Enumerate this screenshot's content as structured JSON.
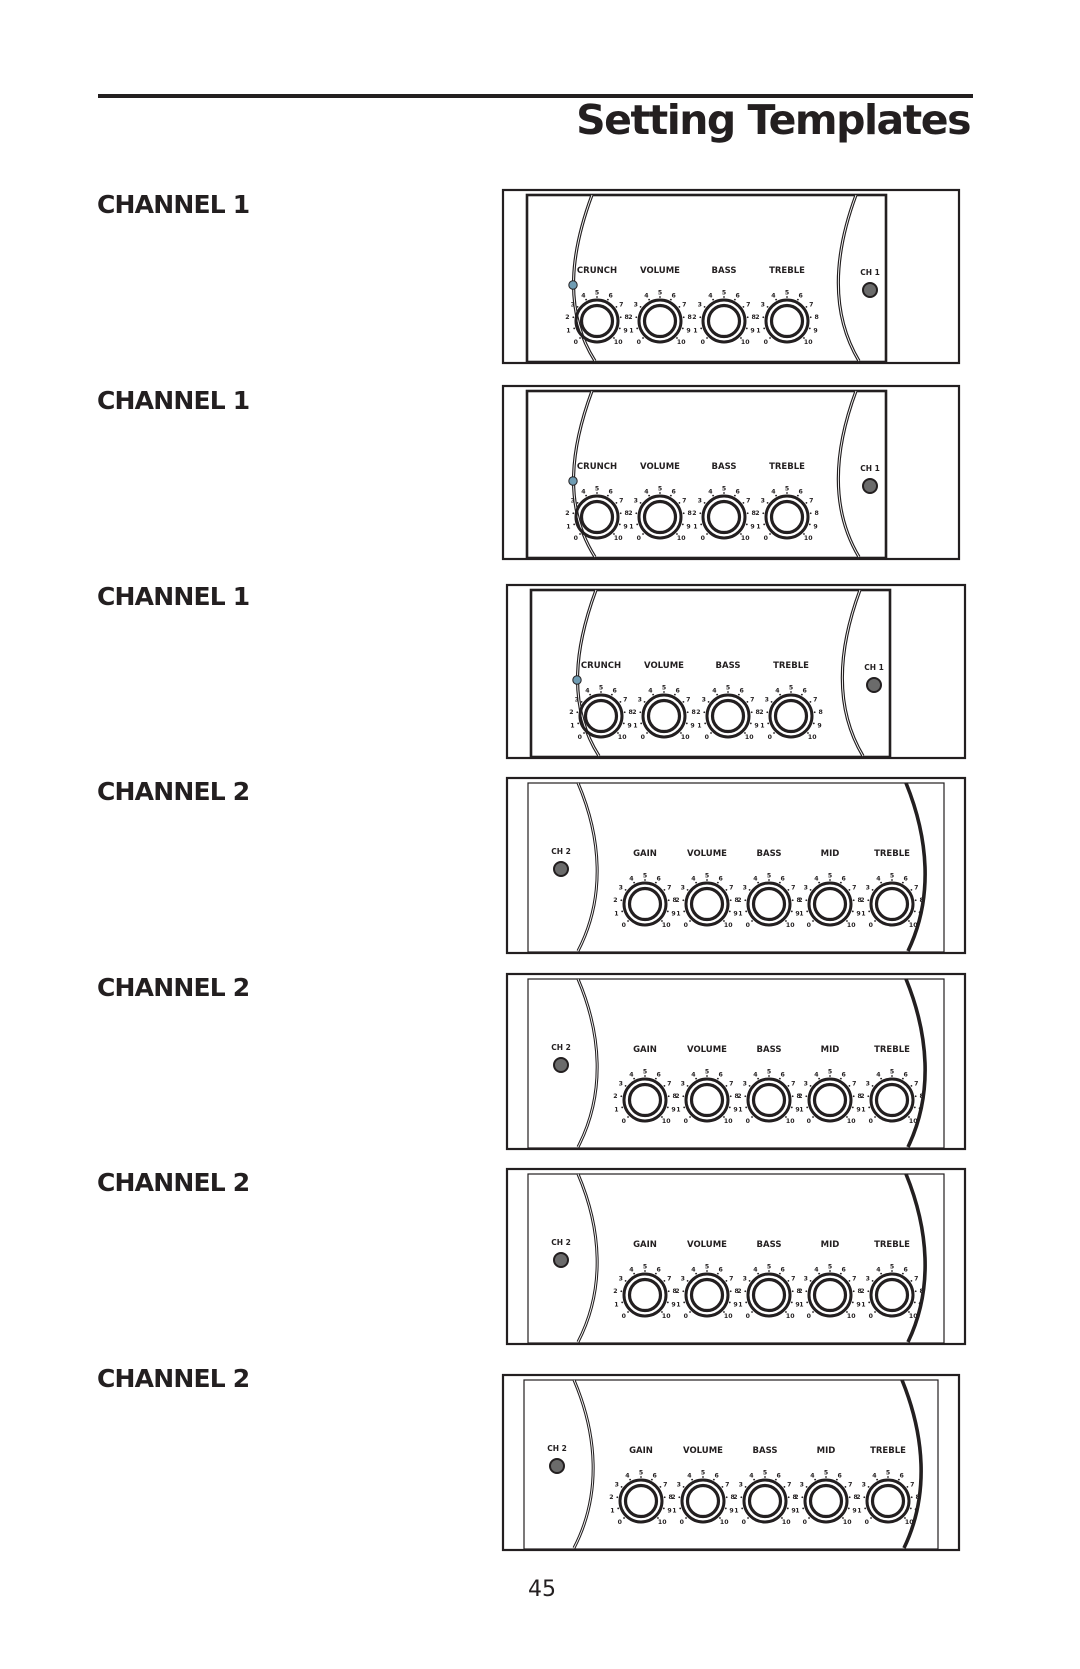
{
  "page": {
    "title": "Setting Templates",
    "page_number": "45"
  },
  "colors": {
    "ink": "#231f20",
    "led_blue": "#6f9cb3",
    "button_gray": "#6b6b6b"
  },
  "knob_scale": [
    "0",
    "1",
    "2",
    "3",
    "4",
    "5",
    "6",
    "7",
    "8",
    "9",
    "10"
  ],
  "templates": [
    {
      "label": "CHANNEL 1",
      "channel": 1,
      "button_label": "CH 1",
      "knobs": [
        "CRUNCH",
        "VOLUME",
        "BASS",
        "TREBLE"
      ]
    },
    {
      "label": "CHANNEL 1",
      "channel": 1,
      "button_label": "CH 1",
      "knobs": [
        "CRUNCH",
        "VOLUME",
        "BASS",
        "TREBLE"
      ]
    },
    {
      "label": "CHANNEL 1",
      "channel": 1,
      "button_label": "CH 1",
      "knobs": [
        "CRUNCH",
        "VOLUME",
        "BASS",
        "TREBLE"
      ]
    },
    {
      "label": "CHANNEL 2",
      "channel": 2,
      "button_label": "CH 2",
      "knobs": [
        "GAIN",
        "VOLUME",
        "BASS",
        "MID",
        "TREBLE"
      ]
    },
    {
      "label": "CHANNEL 2",
      "channel": 2,
      "button_label": "CH 2",
      "knobs": [
        "GAIN",
        "VOLUME",
        "BASS",
        "MID",
        "TREBLE"
      ]
    },
    {
      "label": "CHANNEL 2",
      "channel": 2,
      "button_label": "CH 2",
      "knobs": [
        "GAIN",
        "VOLUME",
        "BASS",
        "MID",
        "TREBLE"
      ]
    },
    {
      "label": "CHANNEL 2",
      "channel": 2,
      "button_label": "CH 2",
      "knobs": [
        "GAIN",
        "VOLUME",
        "BASS",
        "MID",
        "TREBLE"
      ]
    }
  ]
}
